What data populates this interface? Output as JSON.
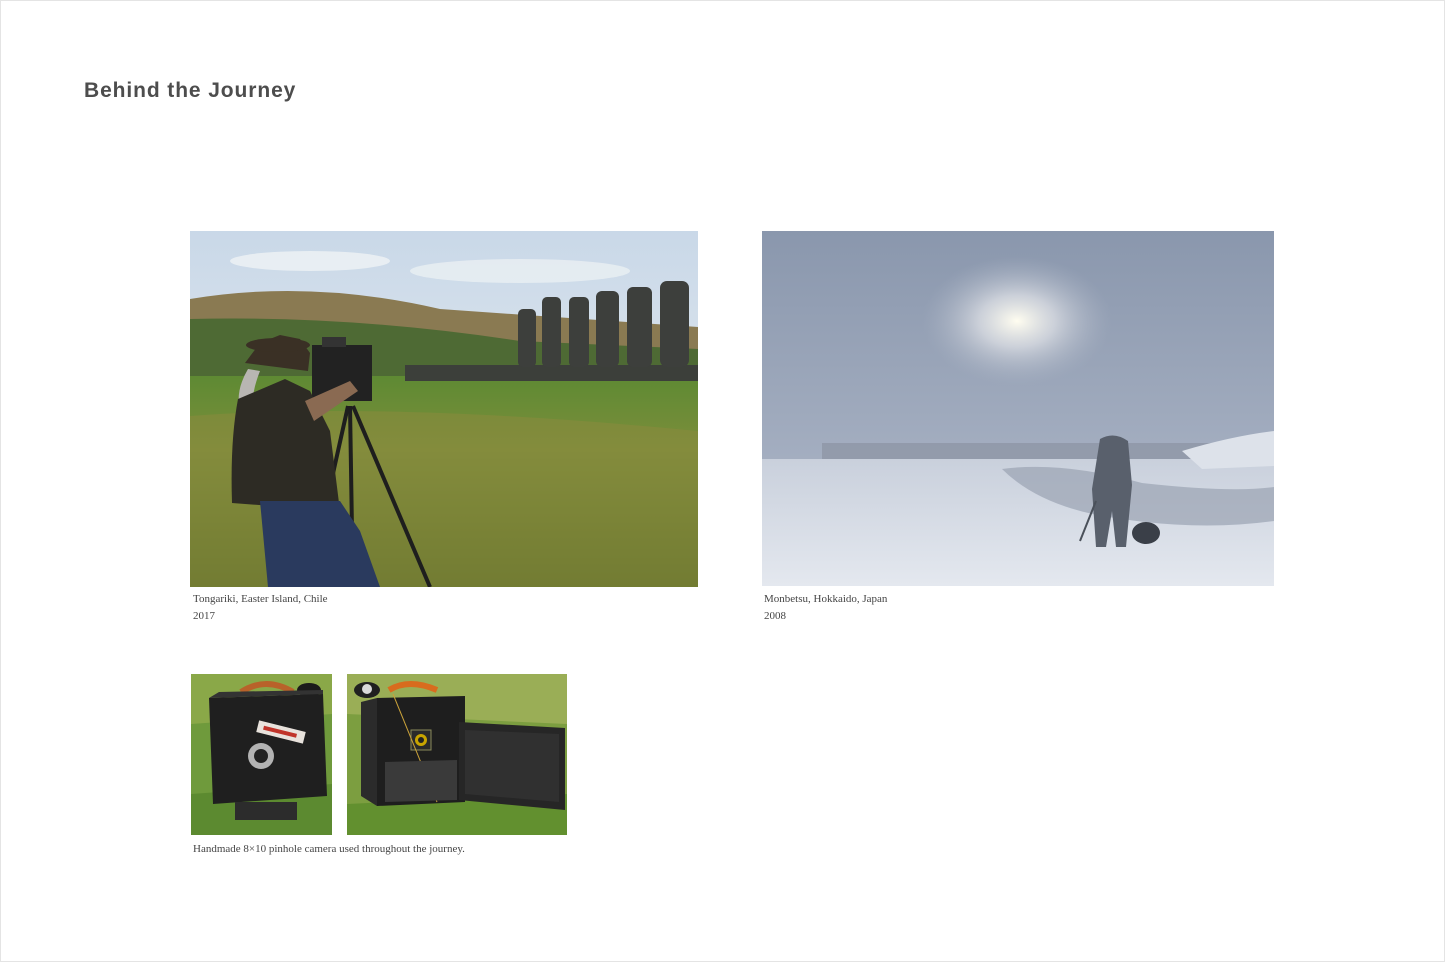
{
  "page": {
    "title": "Behind the Journey"
  },
  "gallery": {
    "photos": [
      {
        "icon": "photographer-with-moai-photo",
        "caption_place": "Tongariki, Easter Island, Chile",
        "caption_year": "2017"
      },
      {
        "icon": "photographer-in-snow-photo",
        "caption_place": "Monbetsu, Hokkaido, Japan",
        "caption_year": "2008"
      }
    ],
    "camera": {
      "icons": [
        "pinhole-camera-closed-photo",
        "pinhole-camera-open-photo"
      ],
      "caption": "Handmade 8×10 pinhole camera used throughout the journey."
    }
  },
  "colors": {
    "title": "#4d4d4d",
    "caption": "#444444",
    "background": "#ffffff"
  }
}
